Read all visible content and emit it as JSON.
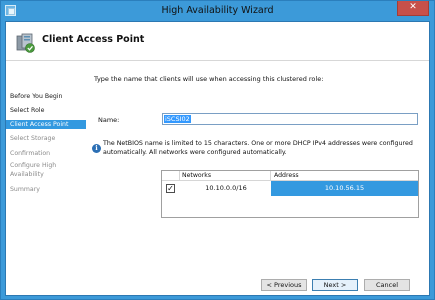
{
  "window": {
    "title": "High Availability Wizard",
    "close_label": "✕"
  },
  "header": {
    "title": "Client Access Point",
    "icon": "cluster-wizard-icon"
  },
  "steps": [
    {
      "label": "Before You Begin",
      "state": "done"
    },
    {
      "label": "Select Role",
      "state": "done"
    },
    {
      "label": "Client Access Point",
      "state": "active"
    },
    {
      "label": "Select Storage",
      "state": "pending"
    },
    {
      "label": "Confirmation",
      "state": "pending"
    },
    {
      "label": "Configure High Availability",
      "state": "pending"
    },
    {
      "label": "Summary",
      "state": "pending"
    }
  ],
  "main": {
    "prompt": "Type the name that clients will use when accessing this clustered role:",
    "name_label": "Name:",
    "name_value": "iSCSI02",
    "info_text": "The NetBIOS name is limited to 15 characters.  One or more DHCP IPv4 addresses were configured automatically.  All networks were configured automatically."
  },
  "grid": {
    "columns": [
      "Networks",
      "Address"
    ],
    "rows": [
      {
        "checked": true,
        "network": "10.10.0.0/16",
        "address": "10.10.56.15"
      }
    ]
  },
  "buttons": {
    "previous": "< Previous",
    "next": "Next >",
    "cancel": "Cancel"
  },
  "colors": {
    "titlebar": "#3c9ad9",
    "selection": "#3399e0",
    "close": "#c7504a"
  }
}
